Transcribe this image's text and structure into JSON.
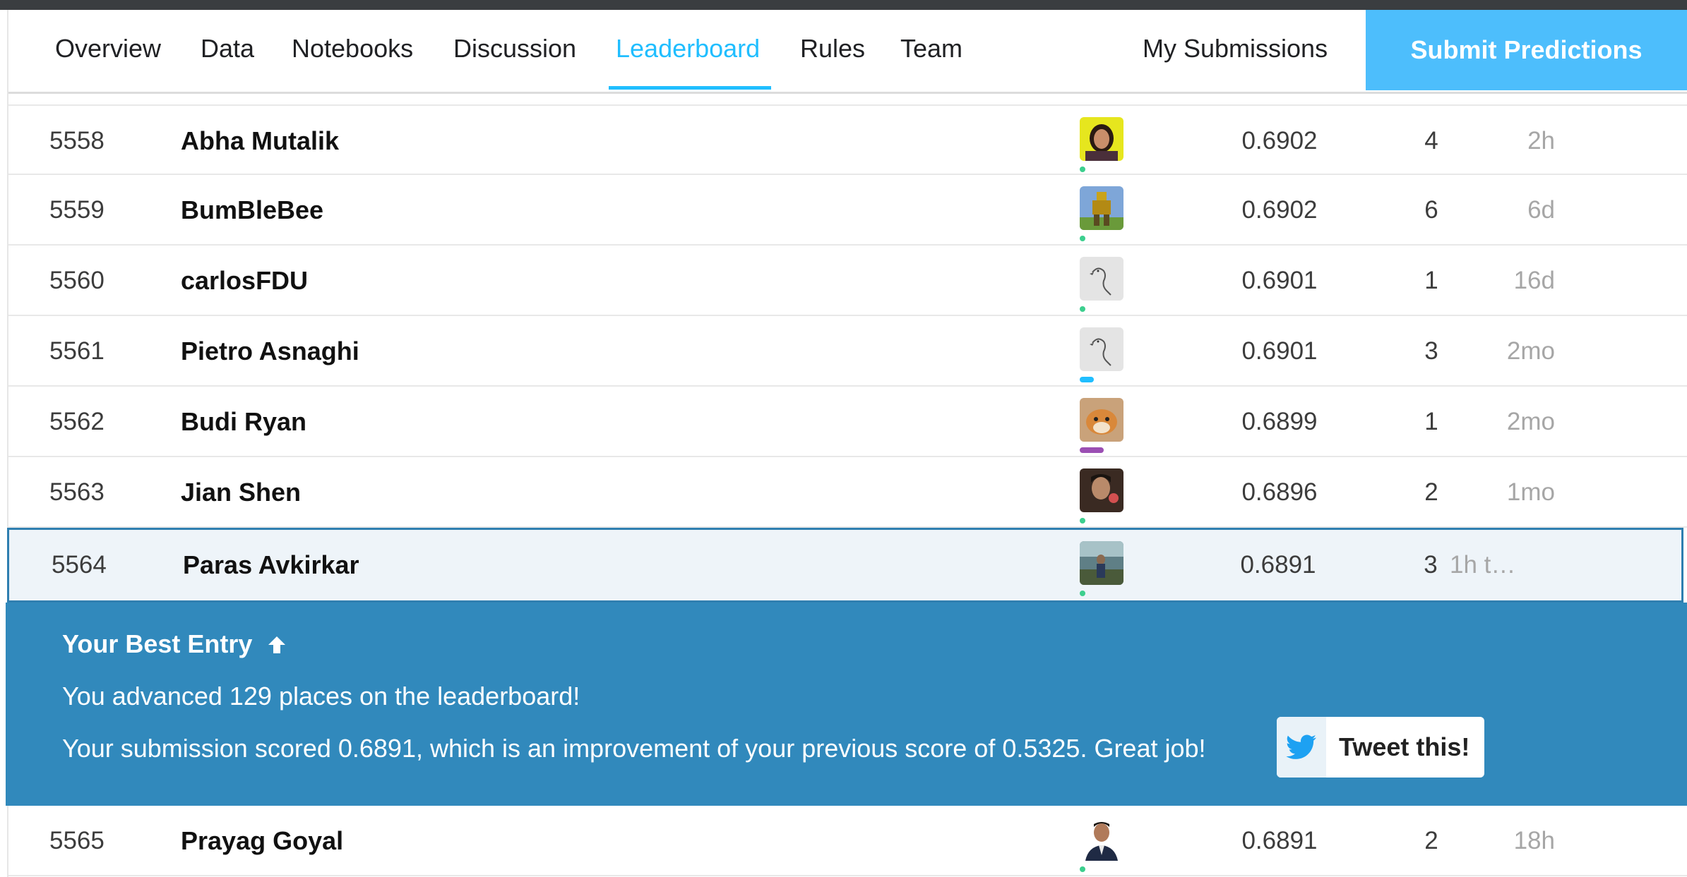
{
  "nav": {
    "tabs": [
      {
        "label": "Overview"
      },
      {
        "label": "Data"
      },
      {
        "label": "Notebooks"
      },
      {
        "label": "Discussion"
      },
      {
        "label": "Leaderboard"
      },
      {
        "label": "Rules"
      },
      {
        "label": "Team"
      }
    ],
    "active_tab": "Leaderboard",
    "my_submissions": "My Submissions",
    "submit_predictions": "Submit Predictions"
  },
  "leaderboard": {
    "rows": [
      {
        "rank": "5558",
        "name": "Abha Mutalik",
        "score": "0.6902",
        "entries": "4",
        "last": "2h",
        "avatar": "woman-portrait",
        "team_dot": "green"
      },
      {
        "rank": "5559",
        "name": "BumBleBee",
        "score": "0.6902",
        "entries": "6",
        "last": "6d",
        "avatar": "robot-figure",
        "team_dot": "green"
      },
      {
        "rank": "5560",
        "name": "carlosFDU",
        "score": "0.6901",
        "entries": "1",
        "last": "16d",
        "avatar": "goose-sketch",
        "team_dot": "green"
      },
      {
        "rank": "5561",
        "name": "Pietro Asnaghi",
        "score": "0.6901",
        "entries": "3",
        "last": "2mo",
        "avatar": "goose-sketch",
        "team_dot": "blue"
      },
      {
        "rank": "5562",
        "name": "Budi Ryan",
        "score": "0.6899",
        "entries": "1",
        "last": "2mo",
        "avatar": "dog-photo",
        "team_dot": "purple"
      },
      {
        "rank": "5563",
        "name": "Jian Shen",
        "score": "0.6896",
        "entries": "2",
        "last": "1mo",
        "avatar": "man-portrait",
        "team_dot": "green"
      },
      {
        "rank": "5564",
        "name": "Paras Avkirkar",
        "score": "0.6891",
        "entries": "3",
        "last": "1h t…",
        "avatar": "outdoor-portrait",
        "team_dot": "green",
        "highlight": true
      },
      {
        "rank": "5565",
        "name": "Prayag Goyal",
        "score": "0.6891",
        "entries": "2",
        "last": "18h",
        "avatar": "suit-portrait",
        "team_dot": "green"
      }
    ]
  },
  "banner": {
    "title": "Your Best Entry",
    "line1": "You advanced 129 places on the leaderboard!",
    "line2": "Your submission scored 0.6891, which is an improvement of your previous score of 0.5325. Great job!",
    "tweet_label": "Tweet this!"
  },
  "colors": {
    "accent": "#20beff",
    "submit_button": "#4dbefc",
    "banner": "#3189bc",
    "highlight_border": "#2f7fb0",
    "dot_green": "#3ccf8e",
    "dot_blue": "#20beff",
    "dot_purple": "#9b4fb3",
    "twitter": "#1da1f2"
  }
}
